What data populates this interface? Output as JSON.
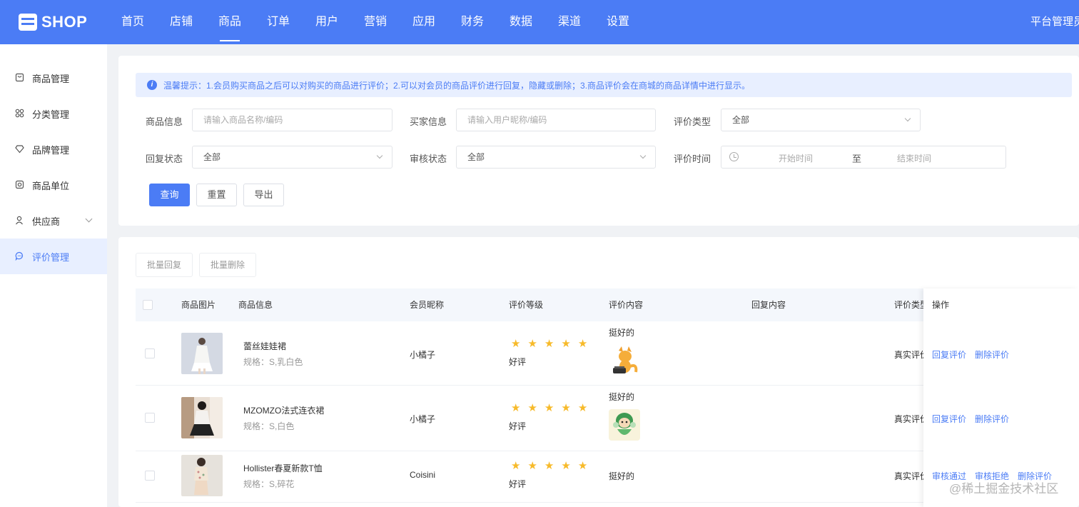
{
  "header": {
    "logo_text": "SHOP",
    "nav": [
      "首页",
      "店铺",
      "商品",
      "订单",
      "用户",
      "营销",
      "应用",
      "财务",
      "数据",
      "渠道",
      "设置"
    ],
    "active_nav": "商品",
    "user": "平台管理员"
  },
  "sidebar": {
    "items": [
      {
        "label": "商品管理",
        "icon": "bag-icon"
      },
      {
        "label": "分类管理",
        "icon": "grid-icon"
      },
      {
        "label": "品牌管理",
        "icon": "diamond-icon"
      },
      {
        "label": "商品单位",
        "icon": "box-icon"
      },
      {
        "label": "供应商",
        "icon": "user-icon"
      },
      {
        "label": "评价管理",
        "icon": "chat-icon"
      }
    ],
    "active": "评价管理"
  },
  "filter": {
    "tip": "温馨提示：1.会员购买商品之后可以对购买的商品进行评价；2.可以对会员的商品评价进行回复，隐藏或删除；3.商品评价会在商城的商品详情中进行显示。",
    "product_label": "商品信息",
    "product_placeholder": "请输入商品名称/编码",
    "buyer_label": "买家信息",
    "buyer_placeholder": "请输入用户昵称/编码",
    "type_label": "评价类型",
    "type_value": "全部",
    "reply_label": "回复状态",
    "reply_value": "全部",
    "audit_label": "审核状态",
    "audit_value": "全部",
    "time_label": "评价时间",
    "time_start": "开始时间",
    "time_sep": "至",
    "time_end": "结束时间",
    "btn_query": "查询",
    "btn_reset": "重置",
    "btn_export": "导出"
  },
  "list": {
    "batch_reply": "批量回复",
    "batch_delete": "批量删除",
    "columns": [
      "商品图片",
      "商品信息",
      "会员昵称",
      "评价等级",
      "评价内容",
      "回复内容",
      "评价类型",
      "操作"
    ],
    "rows": [
      {
        "name": "蕾丝娃娃裙",
        "spec": "规格：S,乳白色",
        "member": "小橘子",
        "stars": 5,
        "grade": "好评",
        "content": "挺好的",
        "has_sticker": true,
        "type": "真实评价",
        "actions": [
          "回复评价",
          "删除评价"
        ]
      },
      {
        "name": "MZOMZO法式连衣裙",
        "spec": "规格：S,白色",
        "member": "小橘子",
        "stars": 5,
        "grade": "好评",
        "content": "挺好的",
        "has_sticker": true,
        "type": "真实评价",
        "actions": [
          "回复评价",
          "删除评价"
        ]
      },
      {
        "name": "Hollister春夏新款T恤",
        "spec": "规格：S,碎花",
        "member": "Coisini",
        "stars": 5,
        "grade": "好评",
        "content": "挺好的",
        "has_sticker": false,
        "type": "真实评价",
        "actions": [
          "审核通过",
          "审核拒绝",
          "删除评价"
        ]
      }
    ]
  },
  "watermark": "@稀土掘金技术社区",
  "colors": {
    "primary": "#4b7cf5",
    "star": "#f7ba2a"
  }
}
